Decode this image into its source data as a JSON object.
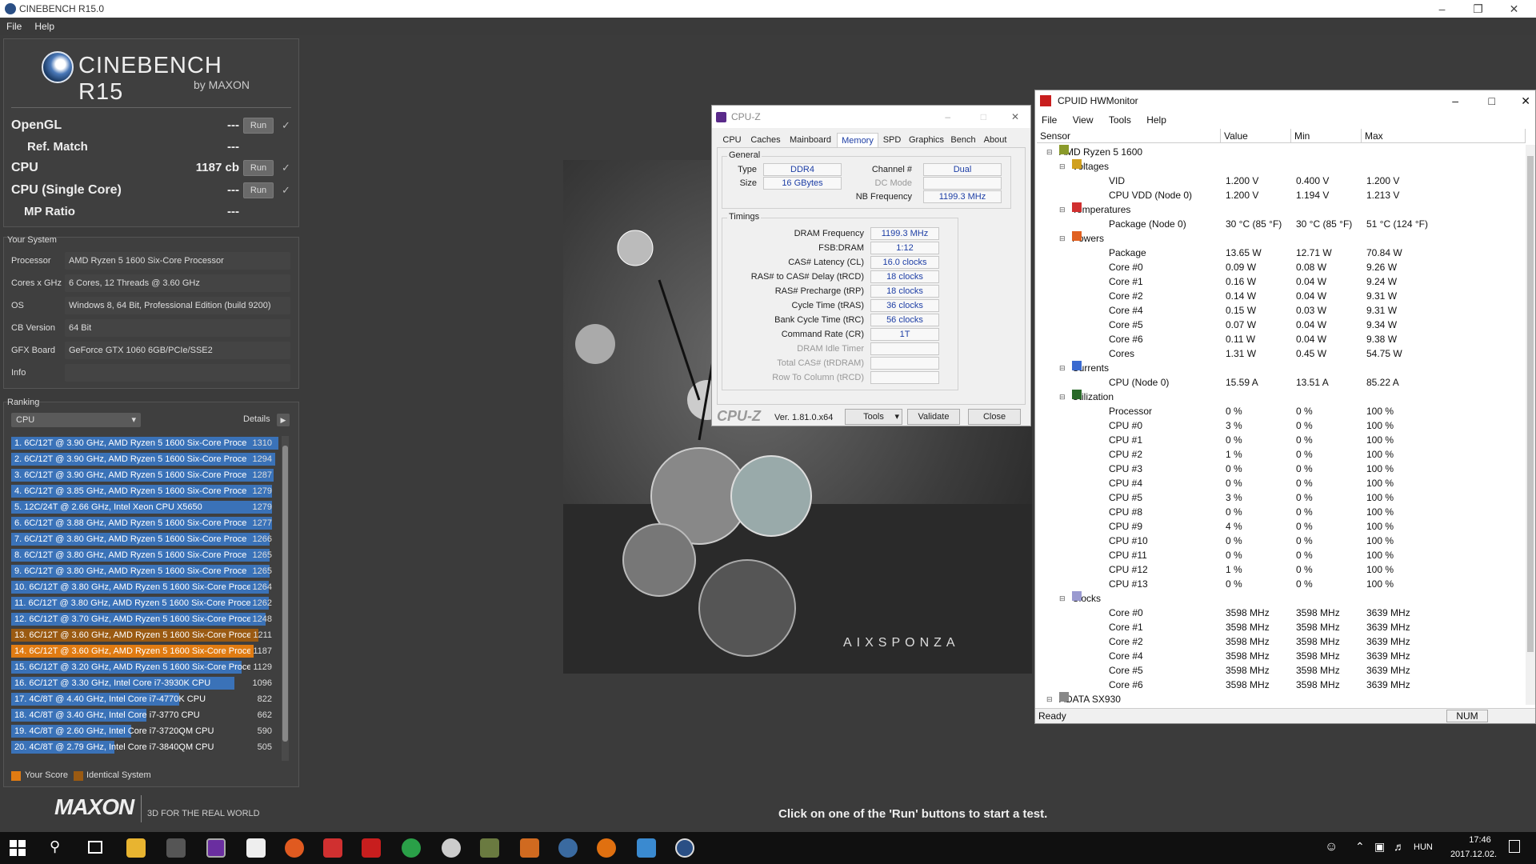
{
  "cinebench": {
    "window_title": "CINEBENCH R15.0",
    "menu": [
      "File",
      "Help"
    ],
    "logo_name": "CINEBENCH R15",
    "logo_by": "by MAXON",
    "tests": [
      {
        "label": "OpenGL",
        "value": "---",
        "run": "Run"
      },
      {
        "label": "Ref. Match",
        "value": "---"
      },
      {
        "label": "CPU",
        "value": "1187 cb",
        "run": "Run"
      },
      {
        "label": "CPU (Single Core)",
        "value": "---",
        "run": "Run"
      },
      {
        "label": "MP Ratio",
        "value": "---"
      }
    ],
    "your_system_title": "Your System",
    "system": [
      {
        "label": "Processor",
        "value": "AMD Ryzen 5 1600 Six-Core Processor"
      },
      {
        "label": "Cores x GHz",
        "value": "6 Cores, 12 Threads @ 3.60 GHz"
      },
      {
        "label": "OS",
        "value": "Windows 8, 64 Bit, Professional Edition (build 9200)"
      },
      {
        "label": "CB Version",
        "value": "64 Bit"
      },
      {
        "label": "GFX Board",
        "value": "GeForce GTX 1060 6GB/PCIe/SSE2"
      },
      {
        "label": "Info",
        "value": ""
      }
    ],
    "ranking_title": "Ranking",
    "ranking_select": "CPU",
    "details_label": "Details",
    "ranking": [
      {
        "text": "1. 6C/12T @ 3.90 GHz, AMD Ryzen 5 1600 Six-Core Proce",
        "score": "1310",
        "kind": "blue"
      },
      {
        "text": "2. 6C/12T @ 3.90 GHz, AMD Ryzen 5 1600 Six-Core Proce",
        "score": "1294",
        "kind": "blue"
      },
      {
        "text": "3. 6C/12T @ 3.90 GHz, AMD Ryzen 5 1600 Six-Core Proce",
        "score": "1287",
        "kind": "blue"
      },
      {
        "text": "4. 6C/12T @ 3.85 GHz, AMD Ryzen 5 1600 Six-Core Proce",
        "score": "1279",
        "kind": "blue"
      },
      {
        "text": "5. 12C/24T @ 2.66 GHz, Intel Xeon CPU X5650",
        "score": "1279",
        "kind": "blue"
      },
      {
        "text": "6. 6C/12T @ 3.88 GHz, AMD Ryzen 5 1600 Six-Core Proce",
        "score": "1277",
        "kind": "blue"
      },
      {
        "text": "7. 6C/12T @ 3.80 GHz, AMD Ryzen 5 1600 Six-Core Proce",
        "score": "1266",
        "kind": "blue"
      },
      {
        "text": "8. 6C/12T @ 3.80 GHz, AMD Ryzen 5 1600 Six-Core Proce",
        "score": "1265",
        "kind": "blue"
      },
      {
        "text": "9. 6C/12T @ 3.80 GHz, AMD Ryzen 5 1600 Six-Core Proce",
        "score": "1265",
        "kind": "blue"
      },
      {
        "text": "10. 6C/12T @ 3.80 GHz, AMD Ryzen 5 1600 Six-Core Proce",
        "score": "1264",
        "kind": "blue"
      },
      {
        "text": "11. 6C/12T @ 3.80 GHz, AMD Ryzen 5 1600 Six-Core Proce",
        "score": "1262",
        "kind": "blue"
      },
      {
        "text": "12. 6C/12T @ 3.70 GHz, AMD Ryzen 5 1600 Six-Core Proce",
        "score": "1248",
        "kind": "blue"
      },
      {
        "text": "13. 6C/12T @ 3.60 GHz, AMD Ryzen 5 1600 Six-Core Proce",
        "score": "1211",
        "kind": "brown"
      },
      {
        "text": "14. 6C/12T @ 3.60 GHz, AMD Ryzen 5 1600 Six-Core Proce",
        "score": "1187",
        "kind": "orange"
      },
      {
        "text": "15. 6C/12T @ 3.20 GHz, AMD Ryzen 5 1600 Six-Core Proce",
        "score": "1129",
        "kind": "blue"
      },
      {
        "text": "16. 6C/12T @ 3.30 GHz,  Intel Core i7-3930K CPU",
        "score": "1096",
        "kind": "blue"
      },
      {
        "text": "17. 4C/8T @ 4.40 GHz, Intel Core i7-4770K CPU",
        "score": "822",
        "kind": "blue"
      },
      {
        "text": "18. 4C/8T @ 3.40 GHz,  Intel Core i7-3770 CPU",
        "score": "662",
        "kind": "blue"
      },
      {
        "text": "19. 4C/8T @ 2.60 GHz, Intel Core i7-3720QM CPU",
        "score": "590",
        "kind": "blue"
      },
      {
        "text": "20. 4C/8T @ 2.79 GHz,  Intel Core i7-3840QM CPU",
        "score": "505",
        "kind": "blue"
      }
    ],
    "legend_your_score": "Your Score",
    "legend_identical": "Identical System",
    "maxon": "MAXON",
    "tagline": "3D FOR THE REAL WORLD",
    "status_message": "Click on one of the 'Run' buttons to start a test.",
    "render_brand": "AIXSPONZA"
  },
  "cpuz": {
    "title": "CPU-Z",
    "tabs": [
      "CPU",
      "Caches",
      "Mainboard",
      "Memory",
      "SPD",
      "Graphics",
      "Bench",
      "About"
    ],
    "active_tab": "Memory",
    "general_title": "General",
    "type_label": "Type",
    "type_value": "DDR4",
    "size_label": "Size",
    "size_value": "16 GBytes",
    "channel_label": "Channel #",
    "channel_value": "Dual",
    "dcmode_label": "DC Mode",
    "nbfreq_label": "NB Frequency",
    "nbfreq_value": "1199.3 MHz",
    "timings_title": "Timings",
    "timings": [
      {
        "label": "DRAM Frequency",
        "value": "1199.3 MHz"
      },
      {
        "label": "FSB:DRAM",
        "value": "1:12"
      },
      {
        "label": "CAS# Latency (CL)",
        "value": "16.0 clocks"
      },
      {
        "label": "RAS# to CAS# Delay (tRCD)",
        "value": "18 clocks"
      },
      {
        "label": "RAS# Precharge (tRP)",
        "value": "18 clocks"
      },
      {
        "label": "Cycle Time (tRAS)",
        "value": "36 clocks"
      },
      {
        "label": "Bank Cycle Time (tRC)",
        "value": "56 clocks"
      },
      {
        "label": "Command Rate (CR)",
        "value": "1T"
      },
      {
        "label": "DRAM Idle Timer",
        "value": ""
      },
      {
        "label": "Total CAS# (tRDRAM)",
        "value": ""
      },
      {
        "label": "Row To Column (tRCD)",
        "value": ""
      }
    ],
    "logo": "CPU-Z",
    "version": "Ver. 1.81.0.x64",
    "tools": "Tools",
    "validate": "Validate",
    "close": "Close"
  },
  "hwmonitor": {
    "title": "CPUID HWMonitor",
    "menu": [
      "File",
      "View",
      "Tools",
      "Help"
    ],
    "columns": [
      "Sensor",
      "Value",
      "Min",
      "Max"
    ],
    "rows": [
      {
        "level": 0,
        "name": "AMD Ryzen 5 1600",
        "value": "",
        "min": "",
        "max": "",
        "icon": "chip"
      },
      {
        "level": 1,
        "name": "Voltages",
        "value": "",
        "min": "",
        "max": "",
        "icon": "volt"
      },
      {
        "level": 2,
        "name": "VID",
        "value": "1.200 V",
        "min": "0.400 V",
        "max": "1.200 V"
      },
      {
        "level": 2,
        "name": "CPU VDD (Node 0)",
        "value": "1.200 V",
        "min": "1.194 V",
        "max": "1.213 V"
      },
      {
        "level": 1,
        "name": "Temperatures",
        "value": "",
        "min": "",
        "max": "",
        "icon": "temp"
      },
      {
        "level": 2,
        "name": "Package (Node 0)",
        "value": "30 °C  (85 °F)",
        "min": "30 °C  (85 °F)",
        "max": "51 °C  (124 °F)"
      },
      {
        "level": 1,
        "name": "Powers",
        "value": "",
        "min": "",
        "max": "",
        "icon": "power"
      },
      {
        "level": 2,
        "name": "Package",
        "value": "13.65 W",
        "min": "12.71 W",
        "max": "70.84 W"
      },
      {
        "level": 2,
        "name": "Core #0",
        "value": "0.09 W",
        "min": "0.08 W",
        "max": "9.26 W"
      },
      {
        "level": 2,
        "name": "Core #1",
        "value": "0.16 W",
        "min": "0.04 W",
        "max": "9.24 W"
      },
      {
        "level": 2,
        "name": "Core #2",
        "value": "0.14 W",
        "min": "0.04 W",
        "max": "9.31 W"
      },
      {
        "level": 2,
        "name": "Core #4",
        "value": "0.15 W",
        "min": "0.03 W",
        "max": "9.31 W"
      },
      {
        "level": 2,
        "name": "Core #5",
        "value": "0.07 W",
        "min": "0.04 W",
        "max": "9.34 W"
      },
      {
        "level": 2,
        "name": "Core #6",
        "value": "0.11 W",
        "min": "0.04 W",
        "max": "9.38 W"
      },
      {
        "level": 2,
        "name": "Cores",
        "value": "1.31 W",
        "min": "0.45 W",
        "max": "54.75 W"
      },
      {
        "level": 1,
        "name": "Currents",
        "value": "",
        "min": "",
        "max": "",
        "icon": "current"
      },
      {
        "level": 2,
        "name": "CPU (Node 0)",
        "value": "15.59 A",
        "min": "13.51 A",
        "max": "85.22 A"
      },
      {
        "level": 1,
        "name": "Utilization",
        "value": "",
        "min": "",
        "max": "",
        "icon": "util"
      },
      {
        "level": 2,
        "name": "Processor",
        "value": "0 %",
        "min": "0 %",
        "max": "100 %"
      },
      {
        "level": 2,
        "name": "CPU #0",
        "value": "3 %",
        "min": "0 %",
        "max": "100 %"
      },
      {
        "level": 2,
        "name": "CPU #1",
        "value": "0 %",
        "min": "0 %",
        "max": "100 %"
      },
      {
        "level": 2,
        "name": "CPU #2",
        "value": "1 %",
        "min": "0 %",
        "max": "100 %"
      },
      {
        "level": 2,
        "name": "CPU #3",
        "value": "0 %",
        "min": "0 %",
        "max": "100 %"
      },
      {
        "level": 2,
        "name": "CPU #4",
        "value": "0 %",
        "min": "0 %",
        "max": "100 %"
      },
      {
        "level": 2,
        "name": "CPU #5",
        "value": "3 %",
        "min": "0 %",
        "max": "100 %"
      },
      {
        "level": 2,
        "name": "CPU #8",
        "value": "0 %",
        "min": "0 %",
        "max": "100 %"
      },
      {
        "level": 2,
        "name": "CPU #9",
        "value": "4 %",
        "min": "0 %",
        "max": "100 %"
      },
      {
        "level": 2,
        "name": "CPU #10",
        "value": "0 %",
        "min": "0 %",
        "max": "100 %"
      },
      {
        "level": 2,
        "name": "CPU #11",
        "value": "0 %",
        "min": "0 %",
        "max": "100 %"
      },
      {
        "level": 2,
        "name": "CPU #12",
        "value": "1 %",
        "min": "0 %",
        "max": "100 %"
      },
      {
        "level": 2,
        "name": "CPU #13",
        "value": "0 %",
        "min": "0 %",
        "max": "100 %"
      },
      {
        "level": 1,
        "name": "Clocks",
        "value": "",
        "min": "",
        "max": "",
        "icon": "clock"
      },
      {
        "level": 2,
        "name": "Core #0",
        "value": "3598 MHz",
        "min": "3598 MHz",
        "max": "3639 MHz"
      },
      {
        "level": 2,
        "name": "Core #1",
        "value": "3598 MHz",
        "min": "3598 MHz",
        "max": "3639 MHz"
      },
      {
        "level": 2,
        "name": "Core #2",
        "value": "3598 MHz",
        "min": "3598 MHz",
        "max": "3639 MHz"
      },
      {
        "level": 2,
        "name": "Core #4",
        "value": "3598 MHz",
        "min": "3598 MHz",
        "max": "3639 MHz"
      },
      {
        "level": 2,
        "name": "Core #5",
        "value": "3598 MHz",
        "min": "3598 MHz",
        "max": "3639 MHz"
      },
      {
        "level": 2,
        "name": "Core #6",
        "value": "3598 MHz",
        "min": "3598 MHz",
        "max": "3639 MHz"
      },
      {
        "level": 0,
        "name": "ADATA SX930",
        "value": "",
        "min": "",
        "max": "",
        "icon": "disk"
      }
    ],
    "status": "Ready",
    "num": "NUM"
  },
  "taskbar": {
    "time": "17:46",
    "date": "2017.12.02.",
    "lang": "HUN"
  }
}
